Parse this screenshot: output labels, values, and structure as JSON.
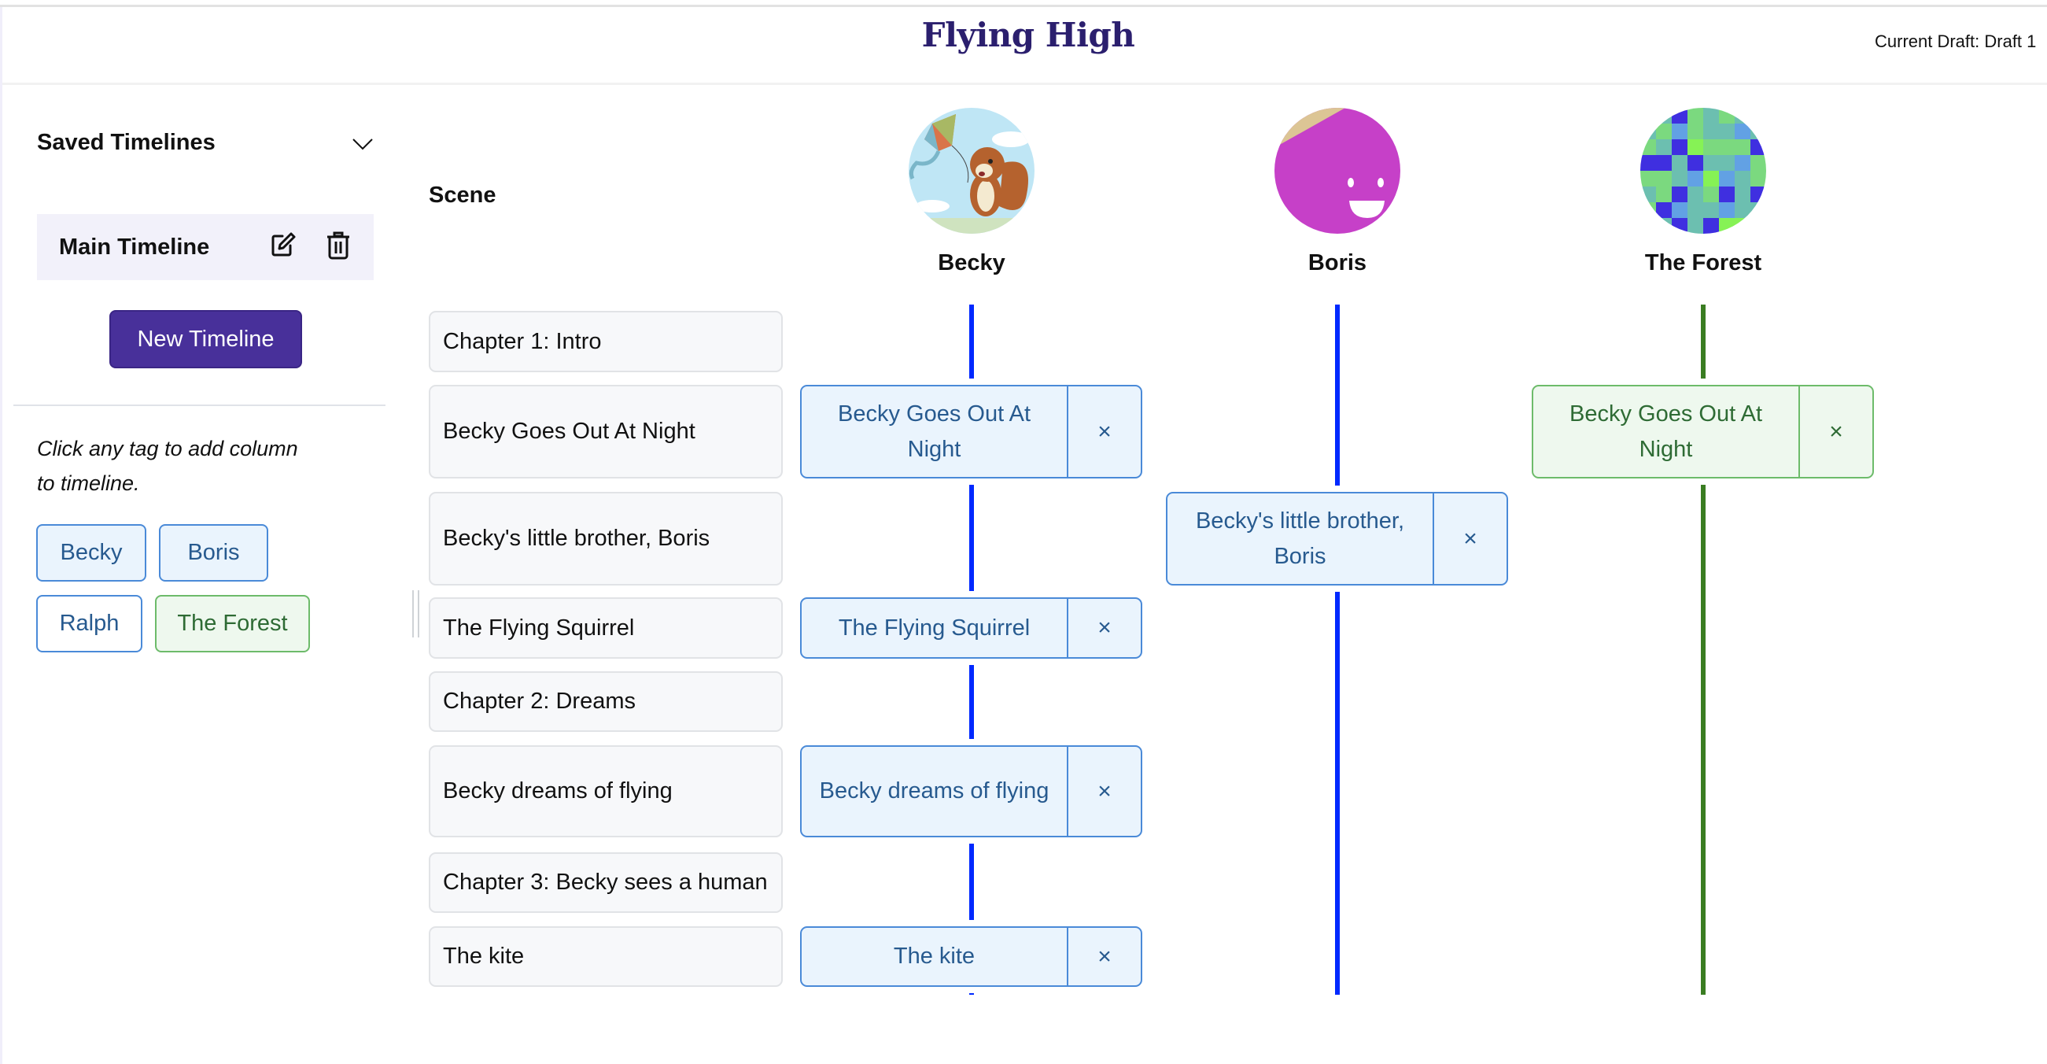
{
  "header": {
    "title": "Flying High",
    "current_draft": "Current Draft: Draft 1"
  },
  "sidebar": {
    "saved_timelines_label": "Saved Timelines",
    "timelines": [
      {
        "label": "Main Timeline",
        "selected": true
      }
    ],
    "new_timeline_label": "New Timeline",
    "hint": "Click any tag to add column to timeline.",
    "tags": [
      {
        "label": "Becky",
        "style": "blue",
        "active": true
      },
      {
        "label": "Boris",
        "style": "blue",
        "active": true
      },
      {
        "label": "Ralph",
        "style": "blue",
        "active": false
      },
      {
        "label": "The Forest",
        "style": "green",
        "active": true
      }
    ]
  },
  "timeline": {
    "scene_header": "Scene",
    "columns": [
      {
        "name": "Becky",
        "avatar": "squirrel-with-kite",
        "line_color": "#0029ff"
      },
      {
        "name": "Boris",
        "avatar": "magenta-smiley",
        "line_color": "#0029ff"
      },
      {
        "name": "The Forest",
        "avatar": "green-blue-pixel-grid",
        "line_color": "#3a7d22"
      }
    ],
    "scenes": [
      {
        "title": "Chapter 1: Intro",
        "cards": [
          null,
          null,
          null
        ]
      },
      {
        "title": "Becky Goes Out At Night",
        "cards": [
          "Becky Goes Out At Night",
          null,
          "Becky Goes Out At Night"
        ]
      },
      {
        "title": "Becky's little brother, Boris",
        "cards": [
          null,
          "Becky's little brother, Boris",
          null
        ]
      },
      {
        "title": "The Flying Squirrel",
        "cards": [
          "The Flying Squirrel",
          null,
          null
        ]
      },
      {
        "title": "Chapter 2: Dreams",
        "cards": [
          null,
          null,
          null
        ]
      },
      {
        "title": "Becky dreams of flying",
        "cards": [
          "Becky dreams of flying",
          null,
          null
        ]
      },
      {
        "title": "Chapter 3: Becky sees a human",
        "cards": [
          null,
          null,
          null
        ]
      },
      {
        "title": "The kite",
        "cards": [
          "The kite",
          null,
          null
        ]
      }
    ],
    "remove_symbol": "×"
  },
  "colors": {
    "brand_purple": "#48309a",
    "title_color": "#2b1f6e",
    "tag_blue_border": "#4a8ad8",
    "tag_blue_bg": "#eaf4fd",
    "tag_green_border": "#6dbb6a",
    "tag_green_bg": "#eef8ee",
    "line_blue": "#0029ff",
    "line_green": "#3a7d22"
  }
}
